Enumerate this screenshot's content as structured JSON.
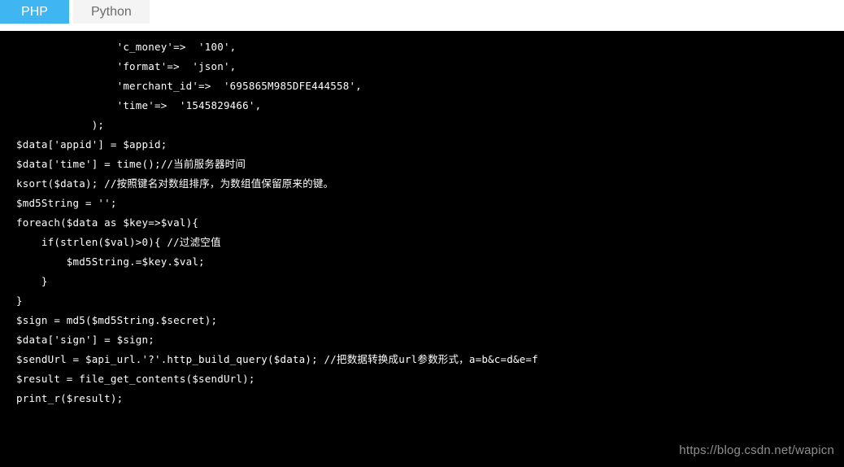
{
  "tabs": [
    {
      "label": "PHP",
      "active": true
    },
    {
      "label": "Python",
      "active": false
    }
  ],
  "colors": {
    "tab_active_bg": "#3fb5f1",
    "tab_active_fg": "#ffffff",
    "tab_inactive_bg": "#f4f4f4",
    "tab_inactive_fg": "#6b6b6b",
    "code_bg": "#000000",
    "code_fg": "#ffffff",
    "watermark_fg": "#8f8f8f"
  },
  "code": {
    "language": "PHP",
    "lines": [
      "                'c_money'=>  '100',",
      "                'format'=>  'json',",
      "                'merchant_id'=>  '695865M985DFE444558',",
      "                'time'=>  '1545829466',",
      "            );",
      "$data['appid'] = $appid;",
      "$data['time'] = time();//当前服务器时间",
      "ksort($data); //按照键名对数组排序，为数组值保留原来的键。",
      "$md5String = '';",
      "foreach($data as $key=>$val){",
      "    if(strlen($val)>0){ //过滤空值",
      "        $md5String.=$key.$val;",
      "    }",
      "}",
      "$sign = md5($md5String.$secret);",
      "$data['sign'] = $sign;",
      "$sendUrl = $api_url.'?'.http_build_query($data); //把数据转换成url参数形式，a=b&c=d&e=f",
      "$result = file_get_contents($sendUrl);",
      "print_r($result);"
    ]
  },
  "watermark": {
    "text": "https://blog.csdn.net/wapicn"
  }
}
